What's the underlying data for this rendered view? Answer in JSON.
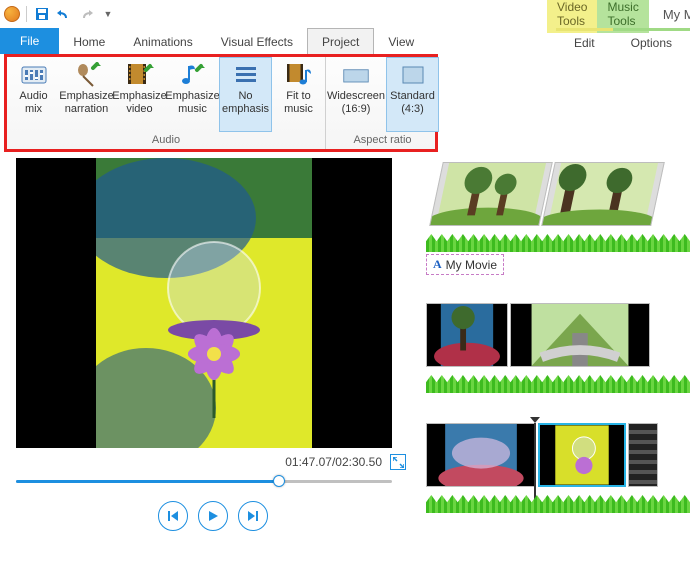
{
  "window": {
    "title": "My Movie - Movie M"
  },
  "contextTabs": {
    "video": "Video Tools",
    "music": "Music Tools"
  },
  "contextSub": {
    "edit": "Edit",
    "options": "Options"
  },
  "menu": {
    "file": "File",
    "home": "Home",
    "animations": "Animations",
    "visualEffects": "Visual Effects",
    "project": "Project",
    "view": "View"
  },
  "ribbon": {
    "audio": {
      "label": "Audio",
      "audioMix": {
        "l1": "Audio",
        "l2": "mix"
      },
      "empNarr": {
        "l1": "Emphasize",
        "l2": "narration"
      },
      "empVid": {
        "l1": "Emphasize",
        "l2": "video"
      },
      "empMus": {
        "l1": "Emphasize",
        "l2": "music"
      },
      "noEmp": {
        "l1": "No",
        "l2": "emphasis"
      },
      "fit": {
        "l1": "Fit to",
        "l2": "music"
      }
    },
    "aspect": {
      "label": "Aspect ratio",
      "wide": {
        "l1": "Widescreen",
        "l2": "(16:9)"
      },
      "std": {
        "l1": "Standard",
        "l2": "(4:3)"
      }
    }
  },
  "player": {
    "time": "01:47.07/02:30.50"
  },
  "timeline": {
    "caption": "My Movie"
  }
}
